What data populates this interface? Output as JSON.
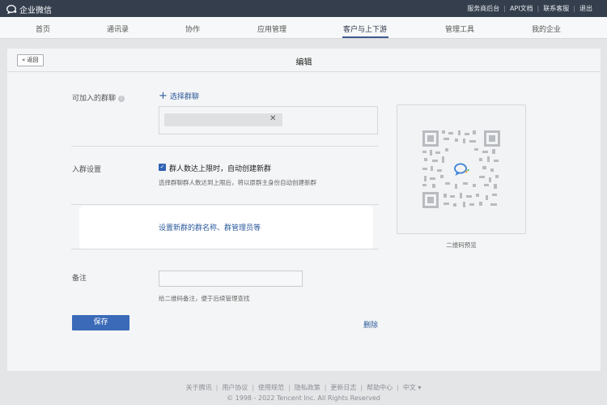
{
  "app": {
    "logo_text": "企业微信"
  },
  "topbar": {
    "links": [
      "服务商后台",
      "API文档",
      "联系客服",
      "退出"
    ]
  },
  "nav": {
    "items": [
      "首页",
      "通讯录",
      "协作",
      "应用管理",
      "客户与上下游",
      "管理工具",
      "我的企业"
    ],
    "active_index": 4
  },
  "page": {
    "back_label": "« 返回",
    "title": "编辑"
  },
  "form": {
    "group_label": "可加入的群聊",
    "select_chat_label": "选择群聊",
    "join_settings_label": "入群设置",
    "auto_create_checked": true,
    "auto_create_label": "群人数达上限时，自动创建新群",
    "auto_create_hint": "选择群聊群人数达到上限后，将以原群主身份自动创建新群",
    "new_group_settings_link": "设置新群的群名称、群管理员等",
    "note_label": "备注",
    "note_value": "",
    "note_hint": "给二维码备注，便于后续管理查找",
    "save_label": "保存",
    "delete_label": "删除"
  },
  "qr": {
    "caption": "二维码预览"
  },
  "footer": {
    "links": [
      "关于腾讯",
      "用户协议",
      "使用规范",
      "隐私政策",
      "更新日志",
      "帮助中心",
      "中文 ▾"
    ],
    "copyright": "© 1998 - 2022 Tencent Inc. All Rights Reserved"
  },
  "colors": {
    "topbar": "#343e4d",
    "accent": "#3a6ab8",
    "link": "#2c5a9b"
  }
}
